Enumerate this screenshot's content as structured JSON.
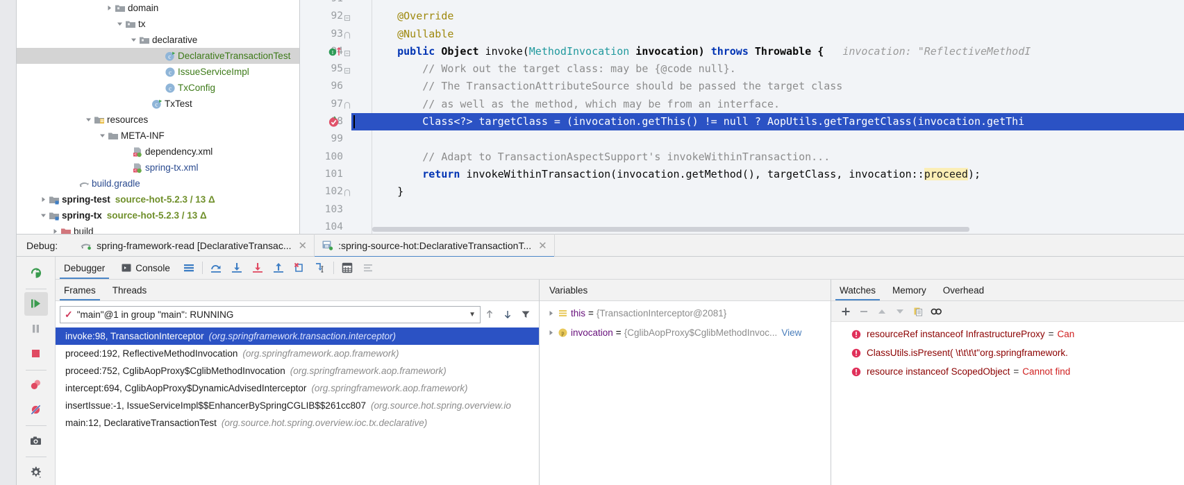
{
  "project_tree": {
    "rows": [
      {
        "indent": 140,
        "twisty": "collapsed",
        "icon": "package-folder-icon",
        "label": "domain",
        "style": "plain",
        "selected": false
      },
      {
        "indent": 155,
        "twisty": "expanded",
        "icon": "package-folder-icon",
        "label": "tx",
        "style": "plain",
        "selected": false
      },
      {
        "indent": 175,
        "twisty": "expanded",
        "icon": "package-folder-icon",
        "label": "declarative",
        "style": "plain",
        "selected": false
      },
      {
        "indent": 212,
        "twisty": "none",
        "icon": "java-class-runnable-icon",
        "label": "DeclarativeTransactionTest",
        "style": "green",
        "selected": true
      },
      {
        "indent": 212,
        "twisty": "none",
        "icon": "java-class-icon",
        "label": "IssueServiceImpl",
        "style": "green",
        "selected": false
      },
      {
        "indent": 212,
        "twisty": "none",
        "icon": "java-class-icon",
        "label": "TxConfig",
        "style": "green",
        "selected": false
      },
      {
        "indent": 193,
        "twisty": "none",
        "icon": "java-class-runnable-icon",
        "label": "TxTest",
        "style": "plain",
        "selected": false
      },
      {
        "indent": 110,
        "twisty": "expanded",
        "icon": "resources-folder-icon",
        "label": "resources",
        "style": "plain",
        "selected": false
      },
      {
        "indent": 130,
        "twisty": "expanded",
        "icon": "folder-icon",
        "label": "META-INF",
        "style": "plain",
        "selected": false
      },
      {
        "indent": 165,
        "twisty": "none",
        "icon": "spring-xml-icon",
        "label": "dependency.xml",
        "style": "plain",
        "selected": false
      },
      {
        "indent": 165,
        "twisty": "none",
        "icon": "spring-xml-icon",
        "label": "spring-tx.xml",
        "style": "blue",
        "selected": false
      },
      {
        "indent": 88,
        "twisty": "none",
        "icon": "gradle-icon",
        "label": "build.gradle",
        "style": "blue",
        "selected": false
      },
      {
        "indent": 45,
        "twisty": "collapsed",
        "icon": "module-folder-icon",
        "label": "spring-test",
        "style": "bold",
        "sub": "source-hot-5.2.3 / 13 Δ",
        "selected": false
      },
      {
        "indent": 45,
        "twisty": "expanded",
        "icon": "module-folder-icon",
        "label": "spring-tx",
        "style": "bold",
        "sub": "source-hot-5.2.3 / 13 Δ",
        "selected": false
      },
      {
        "indent": 62,
        "twisty": "collapsed",
        "icon": "build-folder-icon",
        "label": "build",
        "style": "plain",
        "selected": false
      }
    ]
  },
  "editor": {
    "lines": [
      {
        "num": "91",
        "segments": [],
        "partial": true
      },
      {
        "num": "92",
        "fold": "square",
        "segments": [
          {
            "t": "    ",
            "c": "plain"
          },
          {
            "t": "@Override",
            "c": "ann"
          }
        ]
      },
      {
        "num": "93",
        "fold": "arc",
        "segments": [
          {
            "t": "    ",
            "c": "plain"
          },
          {
            "t": "@Nullable",
            "c": "ann"
          }
        ]
      },
      {
        "num": "94",
        "fold": "square",
        "gutter_icons": "impl-override-icon",
        "segments": [
          {
            "t": "    ",
            "c": "plain"
          },
          {
            "t": "public ",
            "c": "kw"
          },
          {
            "t": "Object ",
            "c": "plain-bold"
          },
          {
            "t": "invoke(",
            "c": "plain"
          },
          {
            "t": "MethodInvocation",
            "c": "typ"
          },
          {
            "t": " invocation) ",
            "c": "plain-bold"
          },
          {
            "t": "throws ",
            "c": "kw"
          },
          {
            "t": "Throwable {",
            "c": "plain-bold"
          },
          {
            "t": "   invocation: \"ReflectiveMethodI",
            "c": "hint"
          }
        ]
      },
      {
        "num": "95",
        "fold": "square",
        "segments": [
          {
            "t": "        // Work out the target class: may be {@code null}.",
            "c": "cmt"
          }
        ]
      },
      {
        "num": "96",
        "segments": [
          {
            "t": "        // The TransactionAttributeSource should be passed the target class",
            "c": "cmt"
          }
        ]
      },
      {
        "num": "97",
        "fold": "arc",
        "segments": [
          {
            "t": "        // as well as the method, which may be from an interface.",
            "c": "cmt"
          }
        ]
      },
      {
        "num": "98",
        "current": true,
        "breakpoint": true,
        "segments": [
          {
            "t": "        Class<?> targetClass = (invocation.getThis() != null ? AopUtils.getTargetClass(invocation.getThi",
            "c": "plain"
          }
        ]
      },
      {
        "num": "99",
        "segments": []
      },
      {
        "num": "100",
        "segments": [
          {
            "t": "        // Adapt to TransactionAspectSupport's invokeWithinTransaction...",
            "c": "cmt"
          }
        ]
      },
      {
        "num": "101",
        "segments": [
          {
            "t": "        ",
            "c": "plain"
          },
          {
            "t": "return ",
            "c": "kw"
          },
          {
            "t": "invokeWithinTransaction(invocation.getMethod(), targetClass, invocation::",
            "c": "plain"
          },
          {
            "t": "proceed",
            "c": "mark"
          },
          {
            "t": ");",
            "c": "plain"
          }
        ]
      },
      {
        "num": "102",
        "fold": "arc",
        "segments": [
          {
            "t": "    }",
            "c": "plain"
          }
        ]
      },
      {
        "num": "103",
        "segments": []
      },
      {
        "num": "104",
        "segments": []
      }
    ]
  },
  "debug_window": {
    "label": "Debug:",
    "tabs": [
      {
        "icon": "gradle-elephant-icon",
        "label": "spring-framework-read [DeclarativeTransac...",
        "closable": true,
        "active": false
      },
      {
        "icon": "run-config-icon",
        "label": ":spring-source-hot:DeclarativeTransactionT...",
        "closable": true,
        "active": true
      }
    ],
    "left_tools": [
      {
        "name": "rerun-icon"
      },
      {
        "name": "resume-program-icon",
        "selected": true
      },
      {
        "name": "pause-program-icon"
      },
      {
        "name": "stop-icon"
      },
      {
        "name": "view-breakpoints-icon"
      },
      {
        "name": "mute-breakpoints-icon"
      },
      {
        "name": "screenshot-icon"
      },
      {
        "name": "settings-icon"
      }
    ],
    "mini_tabs": [
      {
        "label": "Debugger",
        "icon": "",
        "active": true
      },
      {
        "label": "Console",
        "icon": "console-icon",
        "active": false
      }
    ],
    "toolbar_buttons": [
      {
        "name": "show-execution-point-icon"
      },
      {
        "name": "step-over-icon"
      },
      {
        "name": "step-into-icon"
      },
      {
        "name": "force-step-into-icon"
      },
      {
        "name": "step-out-icon"
      },
      {
        "name": "drop-frame-icon"
      },
      {
        "name": "run-to-cursor-icon"
      },
      {
        "name": "evaluate-expression-icon"
      },
      {
        "name": "trace-current-stream-icon"
      }
    ]
  },
  "frames_panel": {
    "tabs": [
      {
        "label": "Frames",
        "active": true
      },
      {
        "label": "Threads",
        "active": false
      }
    ],
    "thread_selector": {
      "value": "\"main\"@1 in group \"main\": RUNNING",
      "check_icon": "check-icon",
      "chevron": "▼"
    },
    "controls": [
      {
        "name": "frame-up-icon",
        "glyph": "↑"
      },
      {
        "name": "frame-down-icon",
        "glyph": "↓"
      },
      {
        "name": "filter-frames-icon",
        "glyph": "filter"
      }
    ],
    "frames": [
      {
        "method": "invoke:98, TransactionInterceptor",
        "package": "(org.springframework.transaction.interceptor)",
        "selected": true
      },
      {
        "method": "proceed:192, ReflectiveMethodInvocation",
        "package": "(org.springframework.aop.framework)",
        "selected": false
      },
      {
        "method": "proceed:752, CglibAopProxy$CglibMethodInvocation",
        "package": "(org.springframework.aop.framework)",
        "selected": false
      },
      {
        "method": "intercept:694, CglibAopProxy$DynamicAdvisedInterceptor",
        "package": "(org.springframework.aop.framework)",
        "selected": false
      },
      {
        "method": "insertIssue:-1, IssueServiceImpl$$EnhancerBySpringCGLIB$$261cc807",
        "package": "(org.source.hot.spring.overview.io",
        "selected": false
      },
      {
        "method": "main:12, DeclarativeTransactionTest",
        "package": "(org.source.hot.spring.overview.ioc.tx.declarative)",
        "selected": false
      }
    ]
  },
  "variables_panel": {
    "title": "Variables",
    "rows": [
      {
        "arrow": "▶",
        "icon": "field-value-icon",
        "name": "this",
        "eq": "=",
        "value": "{TransactionInterceptor@2081}",
        "view": ""
      },
      {
        "arrow": "▶",
        "icon": "parameter-icon",
        "name": "invocation",
        "eq": "=",
        "value": "{CglibAopProxy$CglibMethodInvoc...",
        "view": "View"
      }
    ]
  },
  "watches_panel": {
    "tabs": [
      {
        "label": "Watches",
        "active": true
      },
      {
        "label": "Memory",
        "active": false
      },
      {
        "label": "Overhead",
        "active": false
      }
    ],
    "toolbar": [
      {
        "name": "add-watch-icon",
        "glyph": "+"
      },
      {
        "name": "remove-watch-icon",
        "glyph": "−"
      },
      {
        "name": "move-watch-up-icon",
        "glyph": "▲"
      },
      {
        "name": "move-watch-down-icon",
        "glyph": "▼"
      },
      {
        "name": "copy-watch-icon",
        "glyph": "copy"
      },
      {
        "name": "inline-watches-icon",
        "glyph": "oo"
      }
    ],
    "rows": [
      {
        "icon": "error-icon",
        "expression": "resourceRef instanceof InfrastructureProxy",
        "eq": "=",
        "value": "Can"
      },
      {
        "icon": "error-icon",
        "expression": "ClassUtils.isPresent( \\t\\t\\t\\t\"org.springframework.",
        "eq": "",
        "value": ""
      },
      {
        "icon": "error-icon",
        "expression": "resource instanceof ScopedObject",
        "eq": "=",
        "value": "Cannot find"
      }
    ]
  },
  "colors": {
    "accent_blue": "#2b52c4",
    "tab_underline": "#4a86c8",
    "error_red": "#d02020",
    "green_class": "#3d7a18",
    "comment_gray": "#8c8c8c",
    "keyword_blue": "#0033b3",
    "annotation_yellow": "#9e880d",
    "highlight_yellow": "#fbeeb5"
  }
}
